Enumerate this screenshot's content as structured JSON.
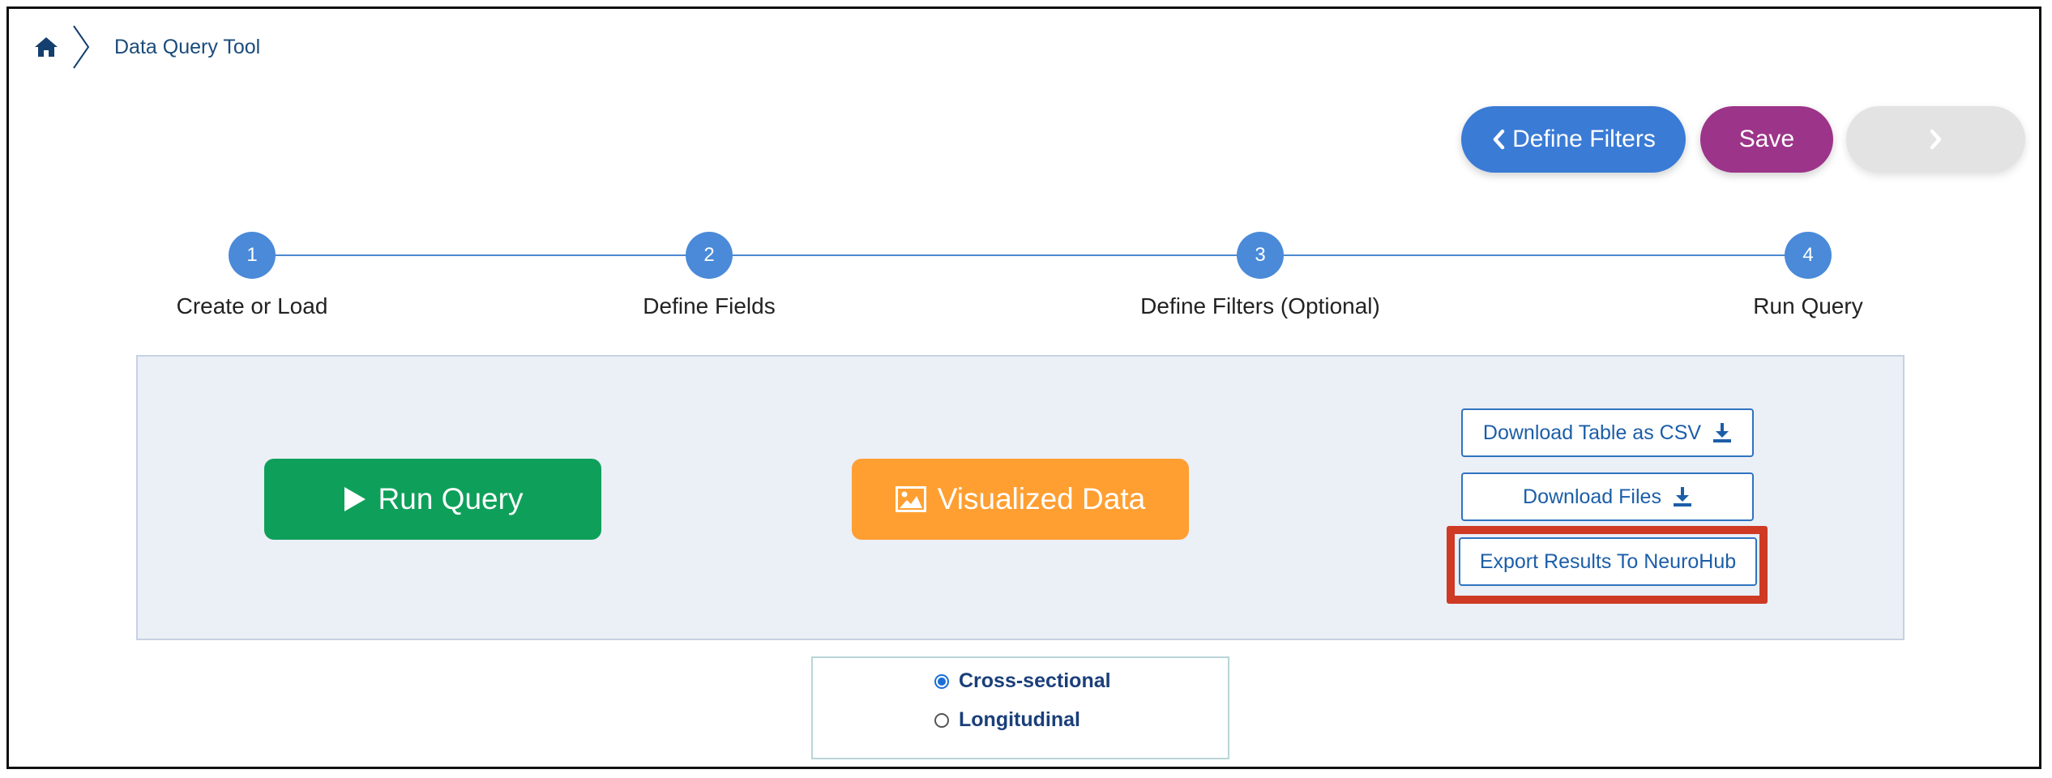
{
  "breadcrumb": {
    "home_icon": "home-icon",
    "current": "Data Query Tool"
  },
  "nav_buttons": {
    "back_label": "Define Filters",
    "save_label": "Save",
    "next_icon": "chevron-right-icon"
  },
  "colors": {
    "primary": "#3a7bd5",
    "save": "#9c3489",
    "disabled": "#e3e3e3",
    "run": "#0ea05a",
    "visualize": "#ff9f32",
    "highlight": "#cf3a24",
    "panel_bg": "#ebeff6",
    "step": "#4a8ad8"
  },
  "steps": [
    {
      "number": "1",
      "label": "Create or Load"
    },
    {
      "number": "2",
      "label": "Define Fields"
    },
    {
      "number": "3",
      "label": "Define Filters (Optional)"
    },
    {
      "number": "4",
      "label": "Run Query"
    }
  ],
  "actions": {
    "run_query": "Run Query",
    "visualize": "Visualized Data",
    "download_csv": "Download Table as CSV",
    "download_files": "Download Files",
    "export": "Export Results To NeuroHub"
  },
  "data_mode": {
    "options": [
      {
        "label": "Cross-sectional",
        "checked": true
      },
      {
        "label": "Longitudinal",
        "checked": false
      }
    ]
  }
}
